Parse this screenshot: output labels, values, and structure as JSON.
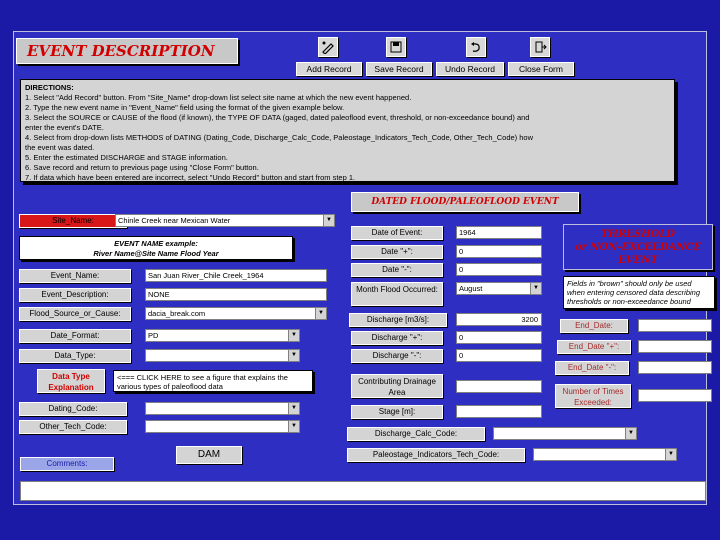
{
  "form": {
    "title": "EVENT DESCRIPTION",
    "toolbar": [
      {
        "label": "Add Record",
        "icon": "pencil-icon"
      },
      {
        "label": "Save Record",
        "icon": "save-icon"
      },
      {
        "label": "Undo Record",
        "icon": "undo-icon"
      },
      {
        "label": "Close Form",
        "icon": "close-door-icon"
      }
    ],
    "directions": [
      "DIRECTIONS:",
      "1.  Select \"Add Record\" button. From \"Site_Name\" drop-down list select site name at which the new event happened.",
      "2.  Type the new event name in \"Event_Name\" field using the format of the given example below.",
      "3.  Select the SOURCE or CAUSE of the flood (if known), the TYPE OF DATA (gaged, dated paleoflood event, threshold, or non-exceedance bound) and",
      "enter the event's DATE.",
      "4.  Select from drop-down lists METHODS of DATING (Dating_Code, Discharge_Calc_Code, Paleostage_Indicators_Tech_Code, Other_Tech_Code) how",
      "the event was dated.",
      "5.  Enter the estimated DISCHARGE and STAGE information.",
      "6.  Save record and return to previous page using \"Close Form\" button.",
      "7.  If data which have been entered are incorrect, select \"Undo Record\" button and start from step 1."
    ],
    "left": {
      "site_name_label": "Site_Name:",
      "site_name_value": "Chinle Creek near Mexican Water",
      "example_line1": "EVENT NAME example:",
      "example_line2": "River Name@Site Name Flood Year",
      "event_name_label": "Event_Name:",
      "event_name_value": "San Juan River_Chile Creek_1964",
      "event_desc_label": "Event_Description:",
      "event_desc_value": "NONE",
      "flood_source_label": "Flood_Source_or_Cause:",
      "flood_source_value": "dacia_break.com",
      "date_format_label": "Date_Format:",
      "date_format_value": "PD",
      "data_type_label": "Data_Type:",
      "data_type_value": "",
      "data_type_expl": "Data Type Explanation",
      "click_here": "<=== CLICK HERE to see a figure that explains the various types of paleoflood data",
      "dating_code_label": "Dating_Code:",
      "other_tech_label": "Other_Tech_Code:",
      "dam_button": "DAM",
      "comments_label": "Comments:"
    },
    "middle": {
      "header": "DATED FLOOD/PALEOFLOOD EVENT",
      "date_of_event_label": "Date of Event:",
      "date_of_event_value": "1964",
      "date_plus_label": "Date \"+\":",
      "date_plus_value": "0",
      "date_minus_label": "Date \"-\":",
      "date_minus_value": "0",
      "month_label": "Month Flood Occurred:",
      "month_value": "August",
      "discharge_label": "Discharge [m3/s]:",
      "discharge_value": "3200",
      "discharge_plus_label": "Discharge \"+\":",
      "discharge_plus_value": "0",
      "discharge_minus_label": "Discharge \"-\":",
      "discharge_minus_value": "0",
      "drainage_label": "Contributing Drainage Area",
      "stage_label": "Stage [m]:",
      "discharge_calc_label": "Discharge_Calc_Code:",
      "paleostage_label": "Paleostage_Indicators_Tech_Code:"
    },
    "right": {
      "header_line1": "THRESHOLD",
      "header_line2": "or NON-EXCEEDANCE",
      "header_line3": "EVENT",
      "note": "Fields in \"brown\" should only be used when entering censored data describing thresholds or non-exceedance bound",
      "end_date_label": "End_Date:",
      "end_date_plus_label": "End_Date \"+\":",
      "end_date_minus_label": "End_Date \"-\":",
      "times_exceeded_label": "Number of Times Exceeded:"
    }
  },
  "colors": {
    "background": "#1a1aa6",
    "form": "#2e2ec2",
    "title_red": "#d10000",
    "site_label_red": "#d81818",
    "brown_text": "#a52a2a"
  }
}
